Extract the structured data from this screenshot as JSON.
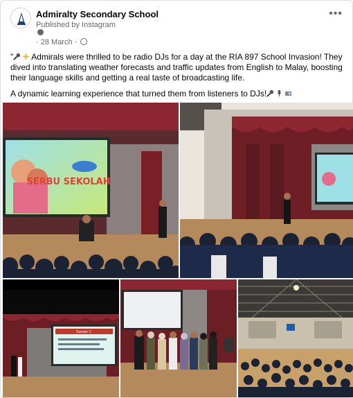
{
  "post": {
    "page_name": "Admiralty Secondary School",
    "published_by": "Published by Instagram",
    "date": "28 March",
    "date_prefix": "·",
    "more_label": "•••",
    "caption_p1": "Admirals were thrilled to be radio DJs for a day at the RIA 897 School Invasion! They dived into translating weather forecasts and traffic updates from English to Malay, boosting their language skills and getting a real taste of broadcasting life.",
    "caption_p2": "A dynamic learning experience that turned them from listeners to DJs!"
  },
  "photos": {
    "screen1_text": "SERBU SEKOLAH",
    "screen4_title": "Soalan 1"
  },
  "icons": {
    "avatar": "school-crest-icon",
    "audience": "globe-icon",
    "pin": "pin-icon",
    "more": "more-options-icon"
  },
  "colors": {
    "text": "#050505",
    "secondary_text": "#65676b",
    "curtain": "#7a1f26"
  }
}
